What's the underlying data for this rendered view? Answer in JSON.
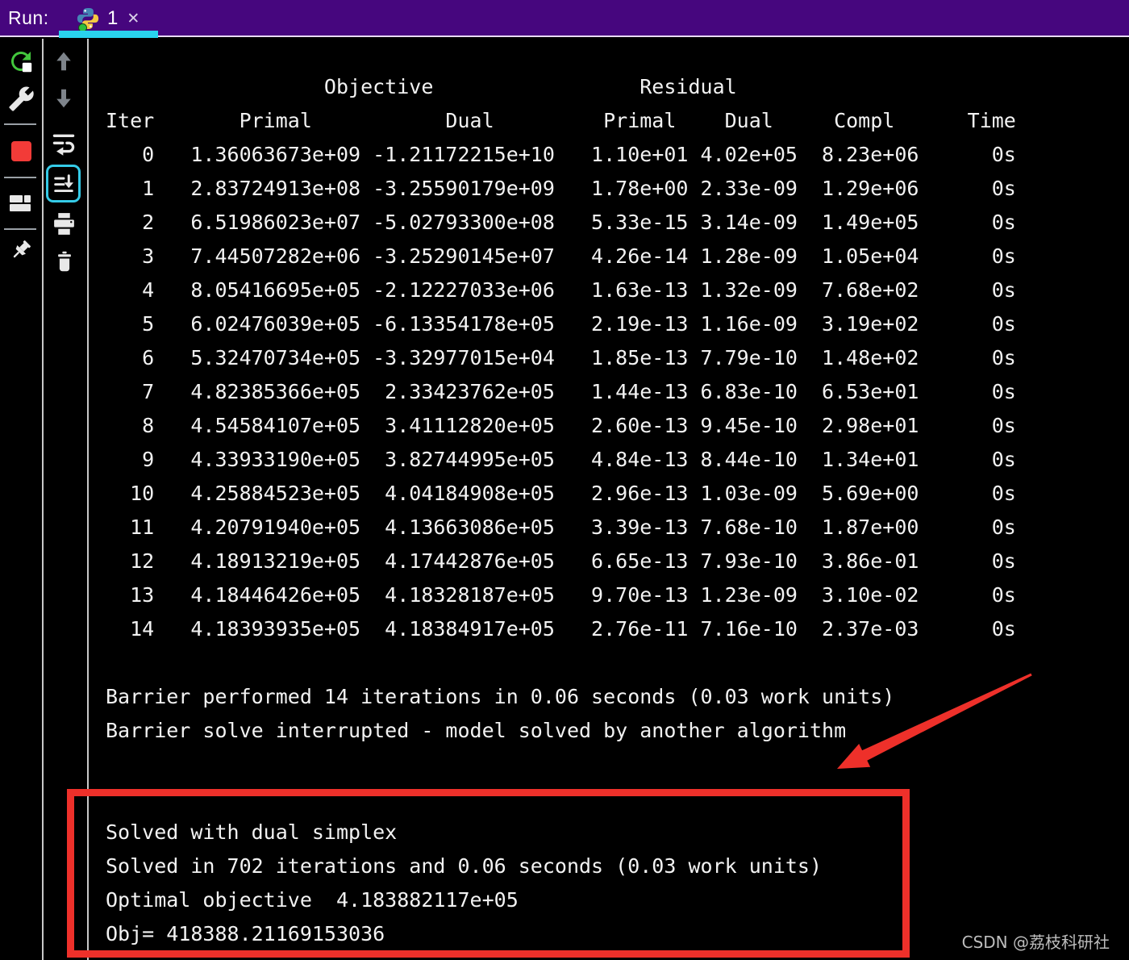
{
  "tab_bar": {
    "run_label": "Run:",
    "tab_label": "1",
    "close_label": "✕"
  },
  "colors": {
    "topbar_bg": "#46067e",
    "tab_underline": "#29d3ee",
    "topbar_divider": "#e9daf3",
    "console_bg": "#000000",
    "console_text": "#f2f2f2",
    "annotation_red": "#ee302a",
    "watermark_gray": "#bdbdbd",
    "run_green": "#43c73d",
    "stop_red": "#f23b38",
    "focus_cyan": "#35cbe8"
  },
  "toolbar_run": {
    "buttons": [
      "rerun",
      "settings",
      "stop",
      "layout",
      "pin"
    ]
  },
  "toolbar_console": {
    "buttons": [
      "scroll-up",
      "scroll-down",
      "soft-wrap",
      "scroll-to-end",
      "print",
      "clear"
    ],
    "selected": "scroll-to-end"
  },
  "console": {
    "group_headers": [
      {
        "label": "Objective",
        "col": 18
      },
      {
        "label": "Residual",
        "col": 44
      }
    ],
    "column_headers": [
      {
        "label": "Iter",
        "col": 0
      },
      {
        "label": "Primal",
        "col": 11
      },
      {
        "label": "Dual",
        "col": 28
      },
      {
        "label": "Primal",
        "col": 41
      },
      {
        "label": "Dual",
        "col": 51
      },
      {
        "label": "Compl",
        "col": 60
      },
      {
        "label": "Time",
        "col": 71
      }
    ],
    "table_rows": [
      [
        0,
        "1.36063673e+09",
        "-1.21172215e+10",
        "1.10e+01",
        "4.02e+05",
        "8.23e+06",
        "0s"
      ],
      [
        1,
        "2.83724913e+08",
        "-3.25590179e+09",
        "1.78e+00",
        "2.33e-09",
        "1.29e+06",
        "0s"
      ],
      [
        2,
        "6.51986023e+07",
        "-5.02793300e+08",
        "5.33e-15",
        "3.14e-09",
        "1.49e+05",
        "0s"
      ],
      [
        3,
        "7.44507282e+06",
        "-3.25290145e+07",
        "4.26e-14",
        "1.28e-09",
        "1.05e+04",
        "0s"
      ],
      [
        4,
        "8.05416695e+05",
        "-2.12227033e+06",
        "1.63e-13",
        "1.32e-09",
        "7.68e+02",
        "0s"
      ],
      [
        5,
        "6.02476039e+05",
        "-6.13354178e+05",
        "2.19e-13",
        "1.16e-09",
        "3.19e+02",
        "0s"
      ],
      [
        6,
        "5.32470734e+05",
        "-3.32977015e+04",
        "1.85e-13",
        "7.79e-10",
        "1.48e+02",
        "0s"
      ],
      [
        7,
        "4.82385366e+05",
        "2.33423762e+05",
        "1.44e-13",
        "6.83e-10",
        "6.53e+01",
        "0s"
      ],
      [
        8,
        "4.54584107e+05",
        "3.41112820e+05",
        "2.60e-13",
        "9.45e-10",
        "2.98e+01",
        "0s"
      ],
      [
        9,
        "4.33933190e+05",
        "3.82744995e+05",
        "4.84e-13",
        "8.44e-10",
        "1.34e+01",
        "0s"
      ],
      [
        10,
        "4.25884523e+05",
        "4.04184908e+05",
        "2.96e-13",
        "1.03e-09",
        "5.69e+00",
        "0s"
      ],
      [
        11,
        "4.20791940e+05",
        "4.13663086e+05",
        "3.39e-13",
        "7.68e-10",
        "1.87e+00",
        "0s"
      ],
      [
        12,
        "4.18913219e+05",
        "4.17442876e+05",
        "6.65e-13",
        "7.93e-10",
        "3.86e-01",
        "0s"
      ],
      [
        13,
        "4.18446426e+05",
        "4.18328187e+05",
        "9.70e-13",
        "1.23e-09",
        "3.10e-02",
        "0s"
      ],
      [
        14,
        "4.18393935e+05",
        "4.18384917e+05",
        "2.76e-11",
        "7.16e-10",
        "2.37e-03",
        "0s"
      ]
    ],
    "messages": [
      "Barrier performed 14 iterations in 0.06 seconds (0.03 work units)",
      "Barrier solve interrupted - model solved by another algorithm"
    ],
    "result_lines": [
      "Solved with dual simplex",
      "Solved in 702 iterations and 0.06 seconds (0.03 work units)",
      "Optimal objective  4.183882117e+05",
      "Obj= 418388.21169153036"
    ]
  },
  "watermark": "CSDN @荔枝科研社"
}
